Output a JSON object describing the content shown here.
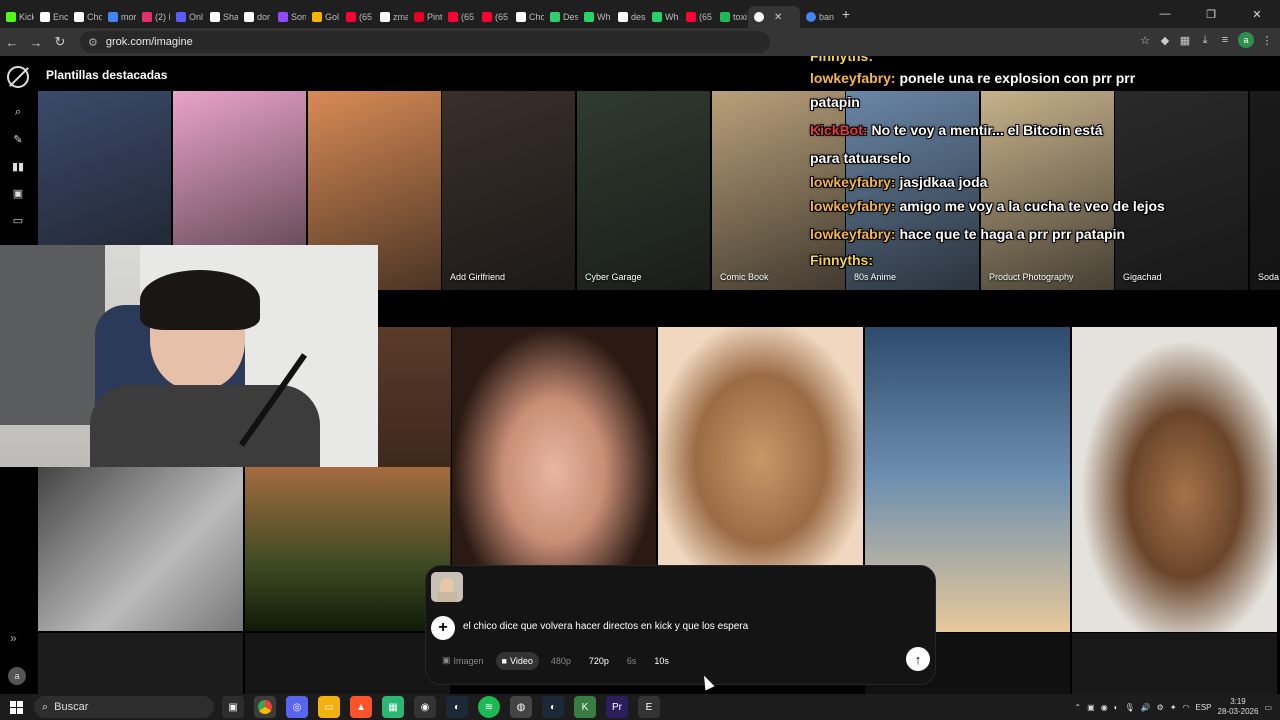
{
  "browser": {
    "tabs": [
      {
        "label": "Kick",
        "color": "#53fc18"
      },
      {
        "label": "Enc",
        "color": "#ffffff"
      },
      {
        "label": "Cho",
        "color": "#ffffff"
      },
      {
        "label": "mor",
        "color": "#4285f4"
      },
      {
        "label": "(2) I",
        "color": "#e1306c"
      },
      {
        "label": "Onl",
        "color": "#5b5bff"
      },
      {
        "label": "Sha",
        "color": "#ffffff"
      },
      {
        "label": "dor",
        "color": "#ffffff"
      },
      {
        "label": "Son",
        "color": "#9146ff"
      },
      {
        "label": "Gol",
        "color": "#f4b400"
      },
      {
        "label": "(65",
        "color": "#ff0033"
      },
      {
        "label": "zma",
        "color": "#ffffff"
      },
      {
        "label": "Pint",
        "color": "#e60023"
      },
      {
        "label": "(65",
        "color": "#ff0033"
      },
      {
        "label": "(65",
        "color": "#ff0033"
      },
      {
        "label": "Cho",
        "color": "#ffffff"
      },
      {
        "label": "Des",
        "color": "#2fd06b"
      },
      {
        "label": "Wh",
        "color": "#25d366"
      },
      {
        "label": "desi",
        "color": "#ffffff"
      },
      {
        "label": "Wh",
        "color": "#25d366"
      },
      {
        "label": "(65",
        "color": "#ff0033"
      },
      {
        "label": "toxi",
        "color": "#1db954"
      }
    ],
    "active_tab": {
      "label": "",
      "color": "#ffffff"
    },
    "tab_after": {
      "label": "ban",
      "color": "#4285f4"
    },
    "url": "grok.com/imagine"
  },
  "page": {
    "section_title": "Plantillas destacadas",
    "templates": [
      {
        "label": "",
        "color": "#3b4a6b"
      },
      {
        "label": "",
        "color": "#e9a3c9"
      },
      {
        "label": "",
        "color": "#d98b55"
      },
      {
        "label": "Add Girlfriend",
        "color": "#3a2f2a"
      },
      {
        "label": "Cyber Garage",
        "color": "#2f3b2f"
      },
      {
        "label": "Comic Book",
        "color": "#b9a07a"
      },
      {
        "label": "80s Anime",
        "color": "#6a87a8"
      },
      {
        "label": "Product Photography",
        "color": "#c7b28a"
      },
      {
        "label": "Gigachad",
        "color": "#2a2a2a"
      },
      {
        "label": "Soda",
        "color": "#1a1a1a"
      }
    ],
    "composer": {
      "prompt": "el chico dice que volvera hacer directos en kick y que los espera",
      "options": {
        "imagen": "Imagen",
        "video": "Video",
        "r480": "480p",
        "r720": "720p",
        "d6": "6s",
        "d10": "10s"
      }
    }
  },
  "chat": {
    "lines": [
      {
        "user": "Finnyths:",
        "msg": ""
      },
      {
        "user": "lowkeyfabry:",
        "msg": "ponele una re explosion con prr prr"
      },
      {
        "user": "",
        "msg": "patapin"
      },
      {
        "user": "KickBot:",
        "msg": "No te voy a mentir... el Bitcoin está"
      },
      {
        "user": "",
        "msg": "para tatuarselo"
      },
      {
        "user": "lowkeyfabry:",
        "msg": "jasjdkaa joda"
      },
      {
        "user": "lowkeyfabry:",
        "msg": "amigo me voy a la cucha te veo de lejos"
      },
      {
        "user": "lowkeyfabry:",
        "msg": "hace que te haga a prr prr patapin"
      },
      {
        "user": "Finnyths:",
        "msg": ""
      }
    ]
  },
  "taskbar": {
    "search_placeholder": "Buscar",
    "lang": "ESP",
    "time": "3:19",
    "date": "28-03-2026"
  }
}
